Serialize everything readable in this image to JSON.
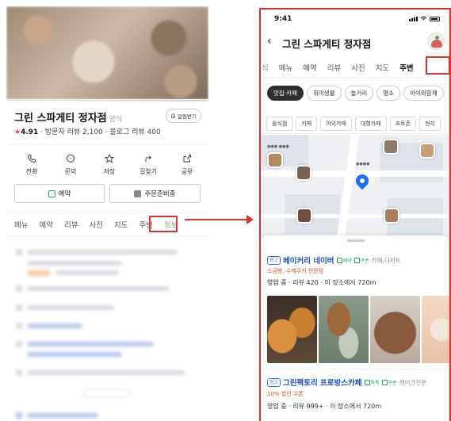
{
  "left_panel": {
    "place_name": "그린 스파게티 정자점",
    "category": "양식",
    "alarm_button": "알림받기",
    "rating": "4.91",
    "visitor_reviews": "· 방문자 리뷰 2,100",
    "blog_reviews": "· 블로그 리뷰 400",
    "actions": [
      {
        "label": "전화",
        "icon": "phone-icon"
      },
      {
        "label": "문의",
        "icon": "chat-icon"
      },
      {
        "label": "저장",
        "icon": "star-icon"
      },
      {
        "label": "길찾기",
        "icon": "directions-icon"
      },
      {
        "label": "공유",
        "icon": "share-icon"
      }
    ],
    "reserve_button": "예약",
    "order_button": "주문준비중",
    "tabs": [
      "메뉴",
      "예약",
      "리뷰",
      "사진",
      "지도",
      "주변",
      "정보"
    ]
  },
  "phone": {
    "time": "9:41",
    "title": "그린 스파게티 정자점",
    "tabs": [
      "식",
      "메뉴",
      "예약",
      "리뷰",
      "사진",
      "지도",
      "주변"
    ],
    "active_tab": "주변",
    "chips": [
      "맛집·카페",
      "취미생활",
      "놀거리",
      "명소",
      "아이와함께"
    ],
    "active_chip": "맛집·카페",
    "subtabs": [
      "음식점",
      "카페",
      "야외카페",
      "대형카페",
      "포토존",
      "현지"
    ],
    "results": [
      {
        "ad": "광고",
        "name": "베이커리 네이버",
        "badges": [
          "예약",
          "쿠폰"
        ],
        "category": "카페,디저트",
        "promo": "소금빵, 수제쿠키 전문점",
        "info": "영업 중 · 리뷰 420 · 이 장소에서 720m"
      },
      {
        "ad": "광고",
        "name": "그린팩토리 프로방스카페",
        "badges": [
          "톡톡",
          "쿠폰"
        ],
        "category": "케이크전문",
        "promo": "10% 할인 쿠폰",
        "info": "영업 중 · 리뷰 999+ · 이 장소에서 720m"
      }
    ]
  },
  "colors": {
    "highlight": "#e03030",
    "link_blue": "#1a4fc4",
    "green": "#1ea85a",
    "promo": "#e05020"
  }
}
